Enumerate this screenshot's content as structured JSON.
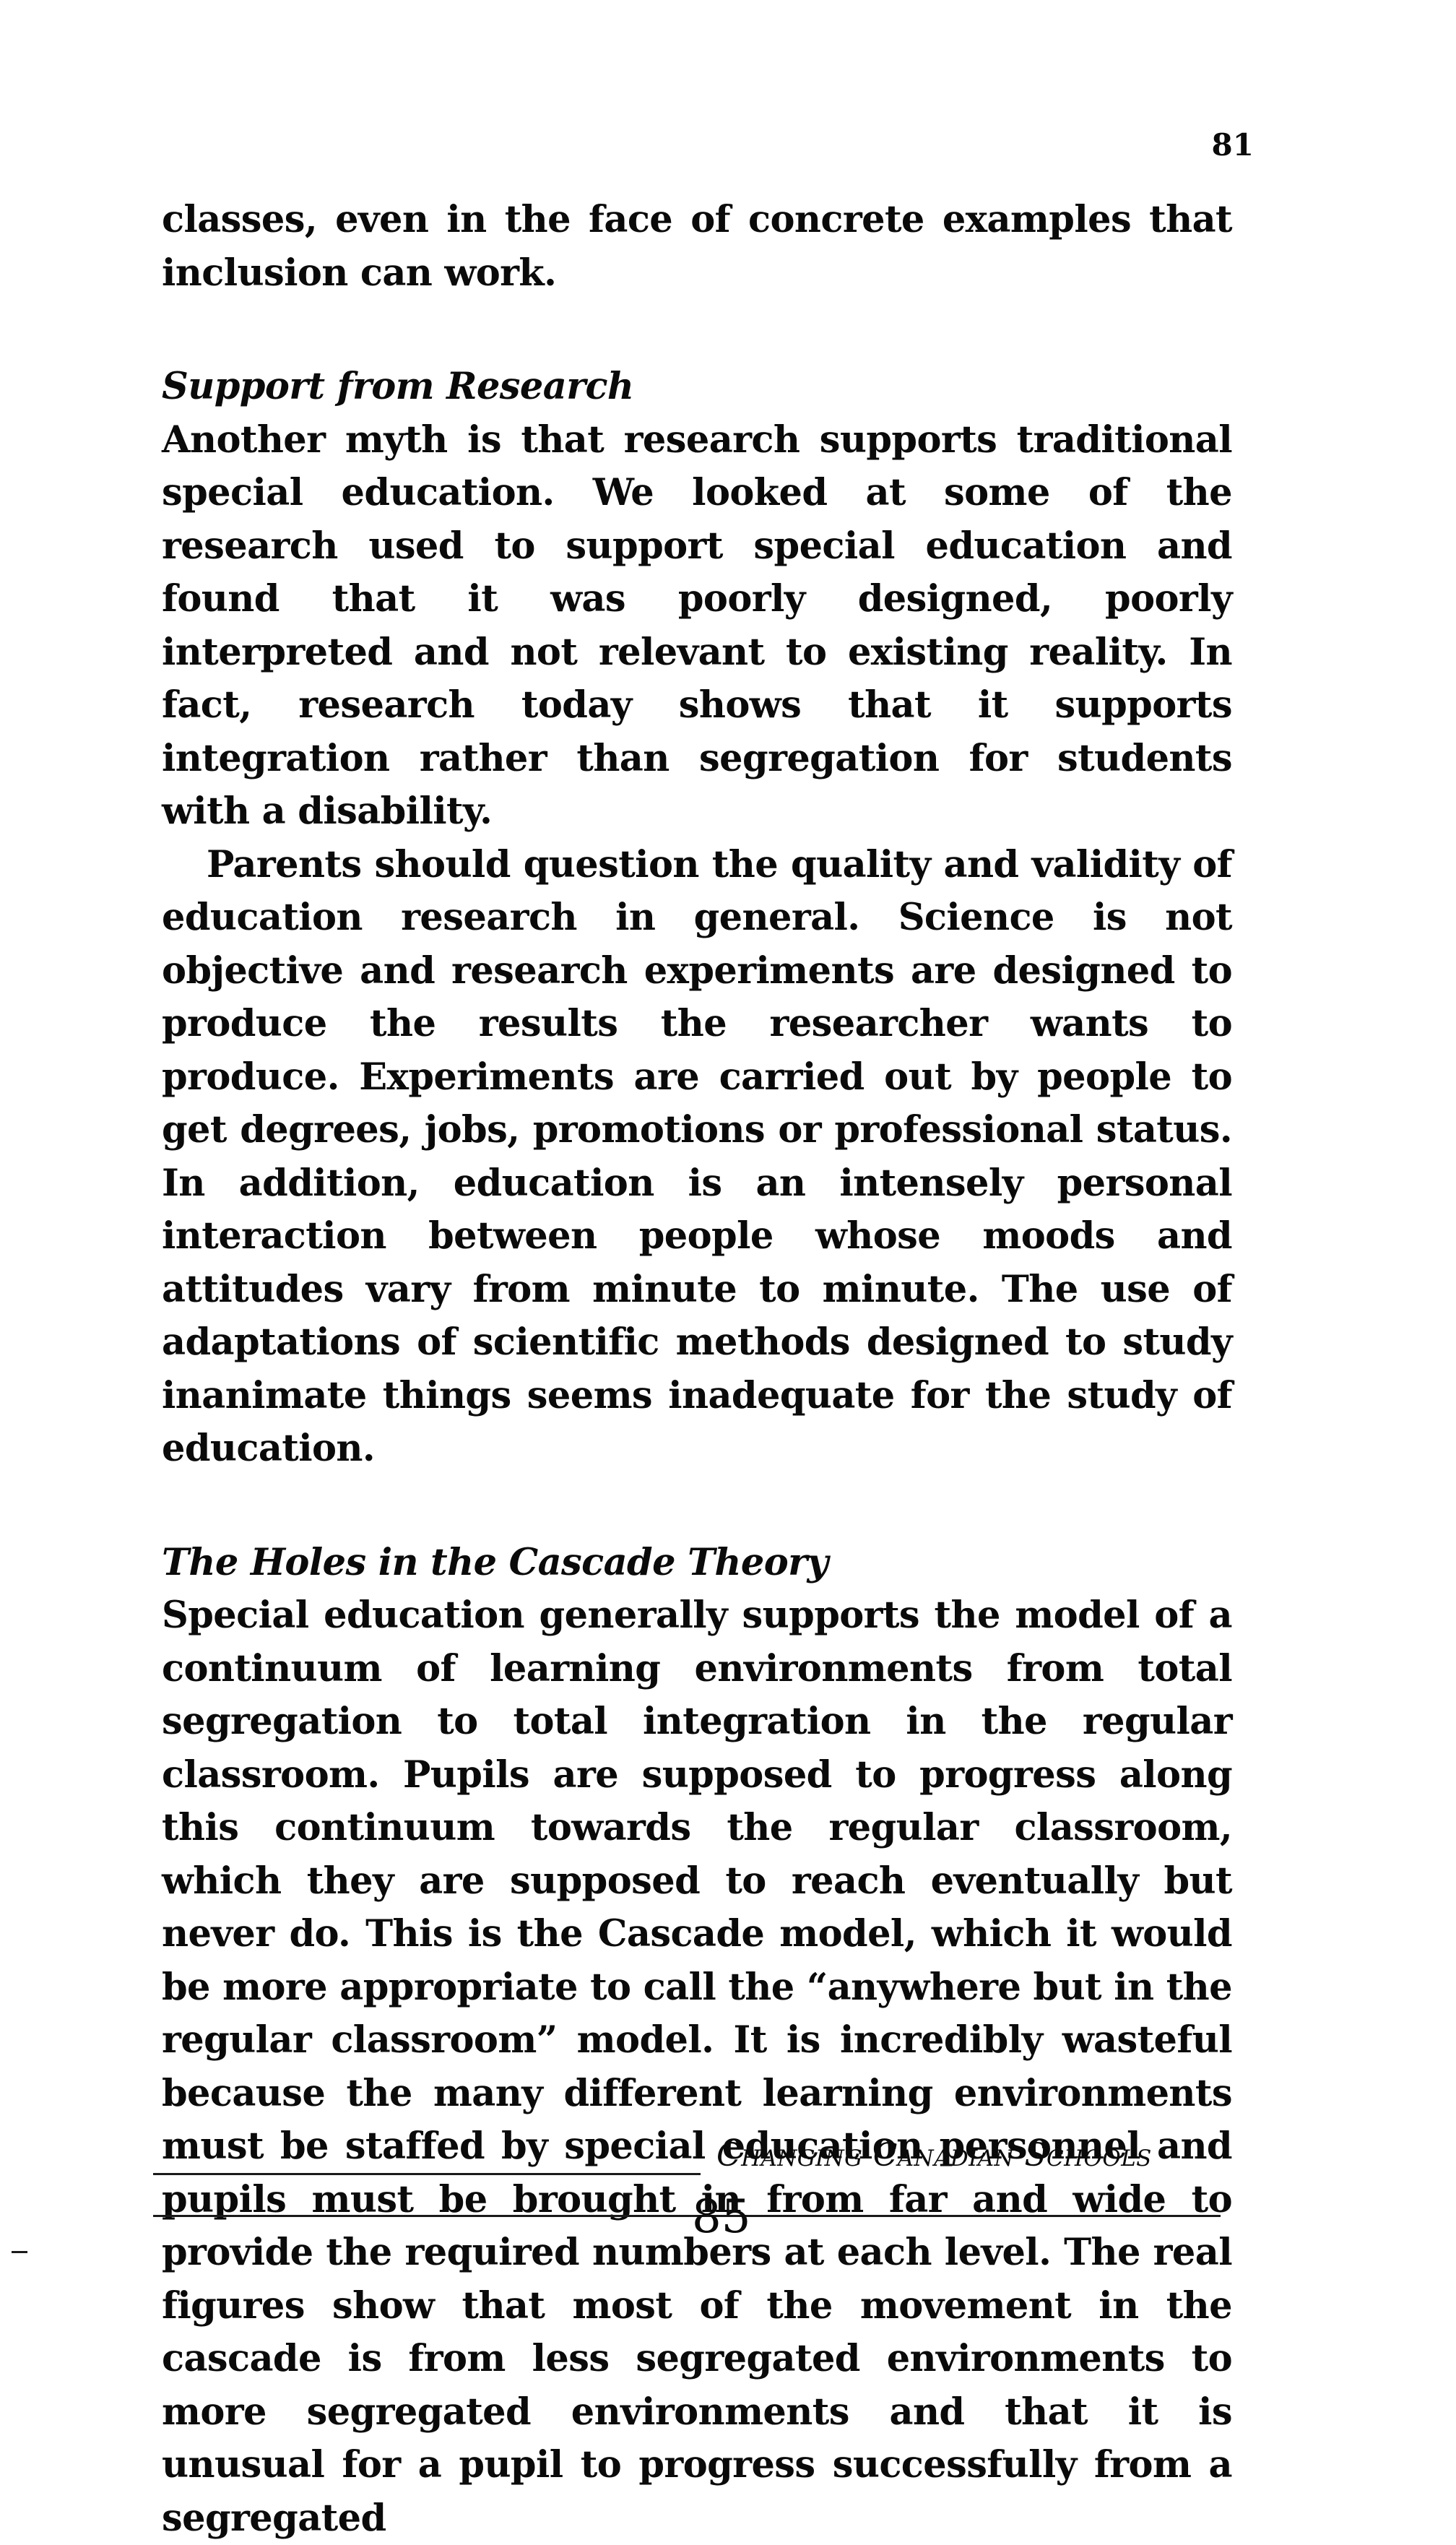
{
  "page": {
    "number": "81"
  },
  "content": {
    "p0": "classes, even in the face of concrete examples that inclusion can work.",
    "h1": "Support from Research",
    "p1": "Another myth is that research supports traditional special education. We looked at some of the research used to support special education and found that it was poorly designed, poorly interpreted and not relevant to existing reality. In fact, research today shows that it supports integration rather than segregation for students with a disability.",
    "p2": "Parents should question the quality and validity of education research in general. Science is not objective and research experiments are designed to produce the results the researcher wants to produce. Experiments are carried out by people to get degrees, jobs, promotions or professional status. In addition, education is an intensely personal interaction between people whose moods and attitudes vary from minute to minute. The use of adaptations of scientific methods designed to study inanimate things seems inadequate for the study of education.",
    "h2": "The Holes in the Cascade Theory",
    "p3": "Special education generally supports the model of a continuum of learning environments from total segregation to total integration in the regular classroom. Pupils are supposed to progress along this continuum towards the regular classroom, which they are supposed to reach eventually but never do. This is the Cascade model, which it would be more appropriate to call the “anywhere but in the regular classroom” model. It is incredibly wasteful because the many different learning environments must be staffed by special education personnel and pupils must be brought in from far and wide to provide the required numbers at each level. The real figures show that most of the movement in the cascade is from less segregated environments to more segregated environments and that it is unusual for a pupil to progress successfully from a segregated"
  },
  "footer": {
    "running_title": "Changing Canadian Schools",
    "page_number": "85"
  }
}
